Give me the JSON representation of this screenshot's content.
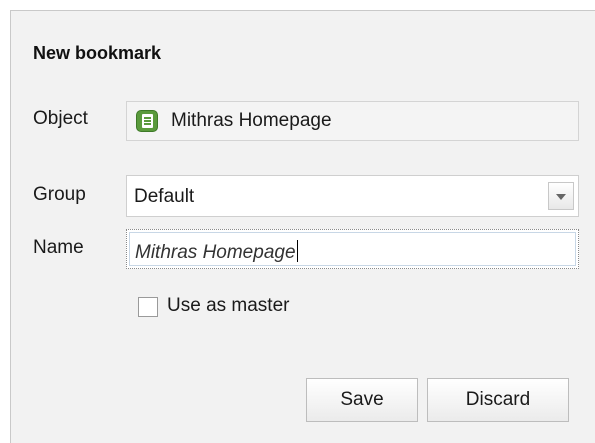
{
  "dialog": {
    "title": "New bookmark"
  },
  "object": {
    "label": "Object",
    "value": "Mithras Homepage",
    "icon": "document-icon",
    "icon_color": "#5a9a3c"
  },
  "group": {
    "label": "Group",
    "selected": "Default"
  },
  "name": {
    "label": "Name",
    "value": "Mithras Homepage"
  },
  "master": {
    "label": "Use as master",
    "checked": false
  },
  "buttons": {
    "save": "Save",
    "discard": "Discard"
  }
}
